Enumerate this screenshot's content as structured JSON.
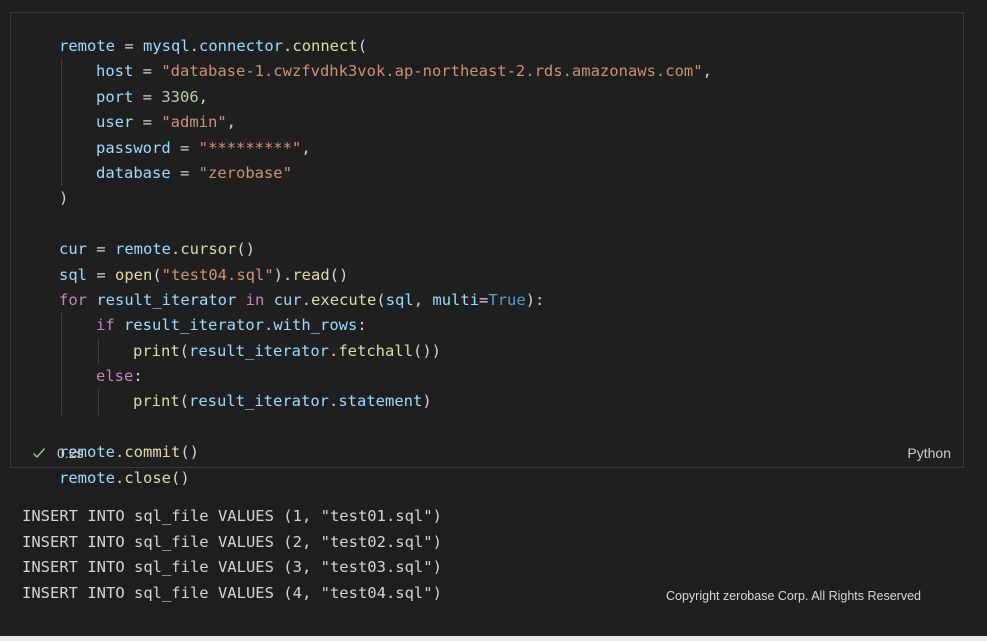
{
  "cell": {
    "lines": [
      {
        "indent": 1,
        "tokens": [
          {
            "t": "remote",
            "c": "var"
          },
          {
            "t": " = ",
            "c": "op"
          },
          {
            "t": "mysql",
            "c": "var"
          },
          {
            "t": ".",
            "c": "op"
          },
          {
            "t": "connector",
            "c": "var"
          },
          {
            "t": ".",
            "c": "op"
          },
          {
            "t": "connect",
            "c": "fn"
          },
          {
            "t": "(",
            "c": "op"
          }
        ]
      },
      {
        "indent": 2,
        "tokens": [
          {
            "t": "host",
            "c": "var"
          },
          {
            "t": " = ",
            "c": "op"
          },
          {
            "t": "\"database-1.cwzfvdhk3vok.ap-northeast-2.rds.amazonaws.com\"",
            "c": "str"
          },
          {
            "t": ",",
            "c": "op"
          }
        ]
      },
      {
        "indent": 2,
        "tokens": [
          {
            "t": "port",
            "c": "var"
          },
          {
            "t": " = ",
            "c": "op"
          },
          {
            "t": "3306",
            "c": "num"
          },
          {
            "t": ",",
            "c": "op"
          }
        ]
      },
      {
        "indent": 2,
        "tokens": [
          {
            "t": "user",
            "c": "var"
          },
          {
            "t": " = ",
            "c": "op"
          },
          {
            "t": "\"admin\"",
            "c": "str"
          },
          {
            "t": ",",
            "c": "op"
          }
        ]
      },
      {
        "indent": 2,
        "tokens": [
          {
            "t": "password",
            "c": "var"
          },
          {
            "t": " = ",
            "c": "op"
          },
          {
            "t": "\"*********\"",
            "c": "str"
          },
          {
            "t": ",",
            "c": "op"
          }
        ]
      },
      {
        "indent": 2,
        "tokens": [
          {
            "t": "database",
            "c": "var"
          },
          {
            "t": " = ",
            "c": "op"
          },
          {
            "t": "\"zerobase\"",
            "c": "str"
          }
        ]
      },
      {
        "indent": 1,
        "tokens": [
          {
            "t": ")",
            "c": "op"
          }
        ]
      },
      {
        "indent": 0,
        "tokens": []
      },
      {
        "indent": 1,
        "tokens": [
          {
            "t": "cur",
            "c": "var"
          },
          {
            "t": " = ",
            "c": "op"
          },
          {
            "t": "remote",
            "c": "var"
          },
          {
            "t": ".",
            "c": "op"
          },
          {
            "t": "cursor",
            "c": "fn"
          },
          {
            "t": "()",
            "c": "op"
          }
        ]
      },
      {
        "indent": 1,
        "tokens": [
          {
            "t": "sql",
            "c": "var"
          },
          {
            "t": " = ",
            "c": "op"
          },
          {
            "t": "open",
            "c": "fn"
          },
          {
            "t": "(",
            "c": "op"
          },
          {
            "t": "\"test04.sql\"",
            "c": "str"
          },
          {
            "t": ").",
            "c": "op"
          },
          {
            "t": "read",
            "c": "fn"
          },
          {
            "t": "()",
            "c": "op"
          }
        ]
      },
      {
        "indent": 1,
        "tokens": [
          {
            "t": "for",
            "c": "kw"
          },
          {
            "t": " ",
            "c": "op"
          },
          {
            "t": "result_iterator",
            "c": "var"
          },
          {
            "t": " ",
            "c": "op"
          },
          {
            "t": "in",
            "c": "kw"
          },
          {
            "t": " ",
            "c": "op"
          },
          {
            "t": "cur",
            "c": "var"
          },
          {
            "t": ".",
            "c": "op"
          },
          {
            "t": "execute",
            "c": "fn"
          },
          {
            "t": "(",
            "c": "op"
          },
          {
            "t": "sql",
            "c": "var"
          },
          {
            "t": ", ",
            "c": "op"
          },
          {
            "t": "multi",
            "c": "var"
          },
          {
            "t": "=",
            "c": "op"
          },
          {
            "t": "True",
            "c": "const"
          },
          {
            "t": "):",
            "c": "op"
          }
        ]
      },
      {
        "indent": 2,
        "tokens": [
          {
            "t": "if",
            "c": "kw"
          },
          {
            "t": " ",
            "c": "op"
          },
          {
            "t": "result_iterator",
            "c": "var"
          },
          {
            "t": ".",
            "c": "op"
          },
          {
            "t": "with_rows",
            "c": "var"
          },
          {
            "t": ":",
            "c": "op"
          }
        ]
      },
      {
        "indent": 3,
        "tokens": [
          {
            "t": "print",
            "c": "fn"
          },
          {
            "t": "(",
            "c": "op"
          },
          {
            "t": "result_iterator",
            "c": "var"
          },
          {
            "t": ".",
            "c": "op"
          },
          {
            "t": "fetchall",
            "c": "fn"
          },
          {
            "t": "())",
            "c": "op"
          }
        ]
      },
      {
        "indent": 2,
        "tokens": [
          {
            "t": "else",
            "c": "kw"
          },
          {
            "t": ":",
            "c": "op"
          }
        ]
      },
      {
        "indent": 3,
        "tokens": [
          {
            "t": "print",
            "c": "fn"
          },
          {
            "t": "(",
            "c": "op"
          },
          {
            "t": "result_iterator",
            "c": "var"
          },
          {
            "t": ".",
            "c": "op"
          },
          {
            "t": "statement",
            "c": "var"
          },
          {
            "t": ")",
            "c": "op"
          }
        ]
      },
      {
        "indent": 0,
        "tokens": []
      },
      {
        "indent": 1,
        "tokens": [
          {
            "t": "remote",
            "c": "var"
          },
          {
            "t": ".",
            "c": "op"
          },
          {
            "t": "commit",
            "c": "fn"
          },
          {
            "t": "()",
            "c": "op"
          }
        ]
      },
      {
        "indent": 1,
        "tokens": [
          {
            "t": "remote",
            "c": "var"
          },
          {
            "t": ".",
            "c": "op"
          },
          {
            "t": "close",
            "c": "fn"
          },
          {
            "t": "()",
            "c": "op"
          }
        ]
      }
    ]
  },
  "status": {
    "check_icon": "check-icon",
    "exec_time": "0.2s",
    "language": "Python"
  },
  "output": {
    "lines": [
      "INSERT INTO sql_file VALUES (1, \"test01.sql\")",
      "INSERT INTO sql_file VALUES (2, \"test02.sql\")",
      "INSERT INTO sql_file VALUES (3, \"test03.sql\")",
      "INSERT INTO sql_file VALUES (4, \"test04.sql\")"
    ]
  },
  "copyright": "Copyright zerobase Corp. All Rights Reserved",
  "colors": {
    "background": "#1e1e1e",
    "check": "#89d185",
    "variable": "#9cdcfe",
    "function": "#dcdcaa",
    "string": "#ce9178",
    "number": "#b5cea8",
    "keyword": "#c586c0",
    "constant": "#569cd6"
  }
}
